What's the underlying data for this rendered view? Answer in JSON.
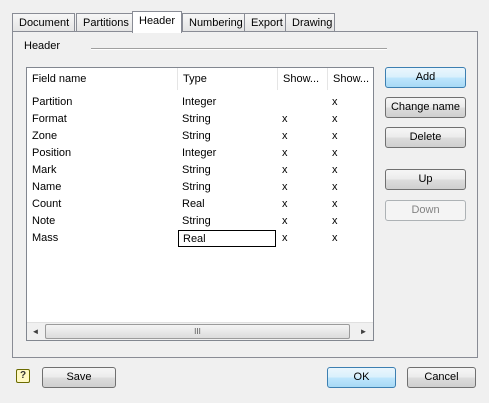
{
  "tabs": [
    "Document",
    "Partitions",
    "Header",
    "Numbering",
    "Export",
    "Drawing"
  ],
  "active_tab": "Header",
  "group": {
    "label": "Header"
  },
  "list": {
    "columns": [
      "Field name",
      "Type",
      "Show...",
      "Show..."
    ],
    "rows": [
      {
        "name": "Partition",
        "type": "Integer",
        "show1": "",
        "show2": "x"
      },
      {
        "name": "Format",
        "type": "String",
        "show1": "x",
        "show2": "x"
      },
      {
        "name": "Zone",
        "type": "String",
        "show1": "x",
        "show2": "x"
      },
      {
        "name": "Position",
        "type": "Integer",
        "show1": "x",
        "show2": "x"
      },
      {
        "name": "Mark",
        "type": "String",
        "show1": "x",
        "show2": "x"
      },
      {
        "name": "Name",
        "type": "String",
        "show1": "x",
        "show2": "x"
      },
      {
        "name": "Count",
        "type": "Real",
        "show1": "x",
        "show2": "x"
      },
      {
        "name": "Note",
        "type": "String",
        "show1": "x",
        "show2": "x"
      },
      {
        "name": "Mass",
        "type": "Real",
        "show1": "x",
        "show2": "x"
      }
    ],
    "editing_row_name": "Mass",
    "scrollbar": {
      "left": "◄",
      "thumb": "III",
      "right": "►"
    }
  },
  "buttons": {
    "add": "Add",
    "change_name": "Change name",
    "delete": "Delete",
    "up": "Up",
    "down": "Down",
    "save": "Save",
    "ok": "OK",
    "cancel": "Cancel"
  },
  "help_icon_glyph": "?"
}
